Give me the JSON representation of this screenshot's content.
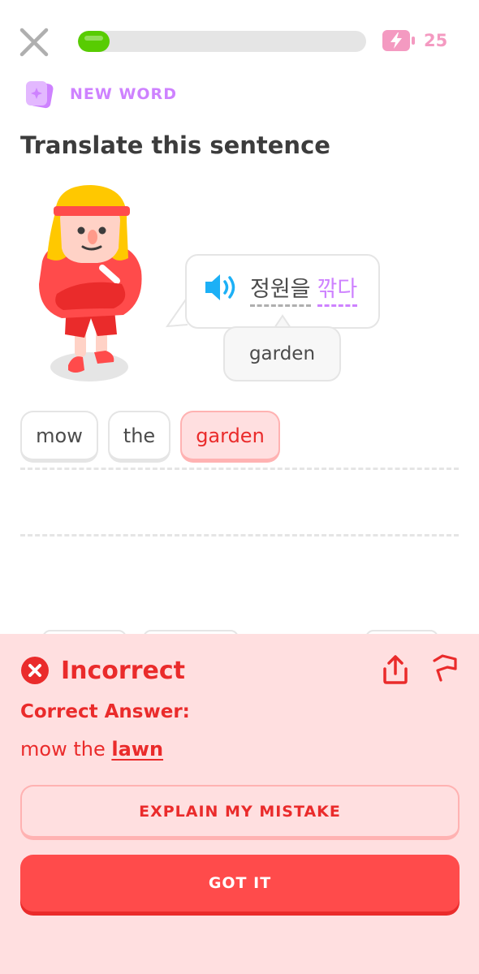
{
  "header": {
    "progress": 0.11,
    "energy": {
      "count": "25",
      "icon": "energy-battery-icon"
    }
  },
  "lesson": {
    "badge": {
      "icon": "new-word-card-icon",
      "label": "NEW WORD"
    },
    "title": "Translate this sentence",
    "prompt": {
      "speaker_icon": "speaker-icon",
      "word_1": "정원을",
      "word_2": "깎다"
    },
    "hint": "garden"
  },
  "answer_tiles": [
    "mow",
    "the",
    "garden"
  ],
  "feedback": {
    "status_icon": "x-circle-icon",
    "status": "Incorrect",
    "correct_label": "Correct Answer:",
    "correct_prefix": "mow the",
    "correct_key": "lawn",
    "explain_button": "EXPLAIN MY MISTAKE",
    "continue_button": "GOT IT"
  },
  "colors": {
    "progress_green": "#58cc02",
    "accent_purple": "#ce82ff",
    "energy_pink": "#f49ac1",
    "error_red": "#ea2b2b",
    "error_bg": "#ffdfe0",
    "button_red": "#ff4b4b"
  }
}
